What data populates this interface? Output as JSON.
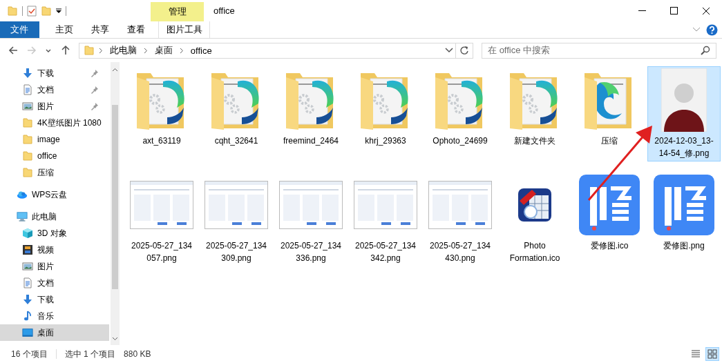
{
  "window": {
    "title": "office",
    "context_group": "管理"
  },
  "ribbon": {
    "tabs": [
      {
        "label": "文件",
        "kind": "file",
        "selected": false
      },
      {
        "label": "主页",
        "kind": "normal",
        "selected": false
      },
      {
        "label": "共享",
        "kind": "normal",
        "selected": false
      },
      {
        "label": "查看",
        "kind": "normal",
        "selected": false
      },
      {
        "label": "图片工具",
        "kind": "context",
        "selected": false
      }
    ]
  },
  "navigation": {
    "buttons": [
      {
        "kind": "back",
        "disabled": false
      },
      {
        "kind": "forward",
        "disabled": true
      },
      {
        "kind": "recent",
        "disabled": false
      },
      {
        "kind": "up",
        "disabled": false
      }
    ]
  },
  "address_bar": {
    "path": [
      "此电脑",
      "桌面",
      "office"
    ]
  },
  "search": {
    "placeholder": "在 office 中搜索"
  },
  "sidebar": {
    "quick_access": [
      {
        "label": "下载",
        "kind": "download",
        "pinned": true,
        "selected": false
      },
      {
        "label": "文档",
        "kind": "document",
        "pinned": true,
        "selected": false
      },
      {
        "label": "图片",
        "kind": "picture",
        "pinned": true,
        "selected": false
      },
      {
        "label": "4K壁纸图片 1080",
        "kind": "folder",
        "pinned": false,
        "selected": false
      },
      {
        "label": "image",
        "kind": "folder",
        "pinned": false,
        "selected": false
      },
      {
        "label": "office",
        "kind": "folder",
        "pinned": false,
        "selected": false
      },
      {
        "label": "压缩",
        "kind": "folder",
        "pinned": false,
        "selected": false
      }
    ],
    "items": [
      {
        "label": "WPS云盘",
        "kind": "cloud",
        "pinned": false,
        "selected": false
      },
      {
        "label": "此电脑",
        "kind": "computer",
        "pinned": false,
        "selected": false,
        "children": [
          {
            "label": "3D 对象",
            "kind": "cube",
            "pinned": false,
            "selected": false
          },
          {
            "label": "视频",
            "kind": "video",
            "pinned": false,
            "selected": false
          },
          {
            "label": "图片",
            "kind": "picture",
            "pinned": false,
            "selected": false
          },
          {
            "label": "文档",
            "kind": "document",
            "pinned": false,
            "selected": false
          },
          {
            "label": "下载",
            "kind": "download",
            "pinned": false,
            "selected": false
          },
          {
            "label": "音乐",
            "kind": "music",
            "pinned": false,
            "selected": false
          },
          {
            "label": "桌面",
            "kind": "desktop",
            "pinned": false,
            "selected": true
          }
        ]
      }
    ]
  },
  "files": [
    {
      "name": "axt_63119",
      "kind": "folder",
      "selected": false
    },
    {
      "name": "cqht_32641",
      "kind": "folder",
      "selected": false
    },
    {
      "name": "freemind_2464",
      "kind": "folder",
      "selected": false
    },
    {
      "name": "khrj_29363",
      "kind": "folder",
      "selected": false
    },
    {
      "name": "Ophoto_24699",
      "kind": "folder",
      "selected": false
    },
    {
      "name": "新建文件夹",
      "kind": "folder",
      "selected": false
    },
    {
      "name": "压缩",
      "kind": "folder-edge",
      "selected": false
    },
    {
      "name": "2024-12-03_13-14-54_修.png",
      "kind": "photo",
      "selected": true
    },
    {
      "name": "2025-05-27_134057.png",
      "kind": "screenshot",
      "selected": false
    },
    {
      "name": "2025-05-27_134309.png",
      "kind": "screenshot",
      "selected": false
    },
    {
      "name": "2025-05-27_134336.png",
      "kind": "screenshot",
      "selected": false
    },
    {
      "name": "2025-05-27_134342.png",
      "kind": "screenshot",
      "selected": false
    },
    {
      "name": "2025-05-27_134430.png",
      "kind": "screenshot",
      "selected": false
    },
    {
      "name": "Photo Formation.ico",
      "kind": "pro-app",
      "selected": false
    },
    {
      "name": "爱修图.ico",
      "kind": "xiu-app",
      "selected": false
    },
    {
      "name": "爱修图.png",
      "kind": "xiu-app",
      "selected": false
    }
  ],
  "status_bar": {
    "item_count": "16 个项目",
    "selection": "选中 1 个项目",
    "size": "880 KB",
    "views": [
      {
        "kind": "details",
        "selected": false
      },
      {
        "kind": "large-icons",
        "selected": true
      }
    ]
  }
}
